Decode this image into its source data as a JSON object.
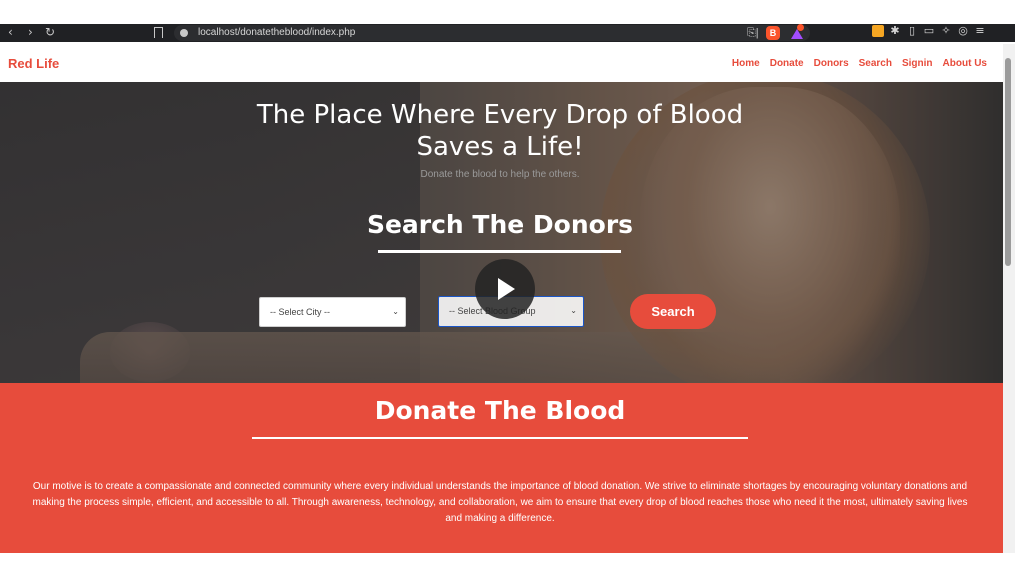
{
  "browser": {
    "back": "‹",
    "forward": "›",
    "reload": "↻",
    "url": "localhost/donatetheblood/index.php",
    "share": "⎘|",
    "brave_label": "B"
  },
  "nav": {
    "brand": "Red Life",
    "links": [
      "Home",
      "Donate",
      "Donors",
      "Search",
      "Signin",
      "About Us"
    ]
  },
  "hero": {
    "title": "The Place Where Every Drop of Blood Saves a Life!",
    "subtitle": "Donate the blood to help the others.",
    "search_title": "Search The Donors",
    "city_select": "-- Select City --",
    "blood_select": "-- Select Blood Group",
    "search_button": "Search"
  },
  "donate": {
    "title": "Donate The Blood",
    "text": "Our motive is to create a compassionate and connected community where every individual understands the importance of blood donation. We strive to eliminate shortages by encouraging voluntary donations and making the process simple, efficient, and accessible to all. Through awareness, technology, and collaboration, we aim to ensure that every drop of blood reaches those who need it the most, ultimately saving lives and making a difference."
  },
  "colors": {
    "accent": "#e74c3c",
    "browser_bar": "#202124"
  }
}
